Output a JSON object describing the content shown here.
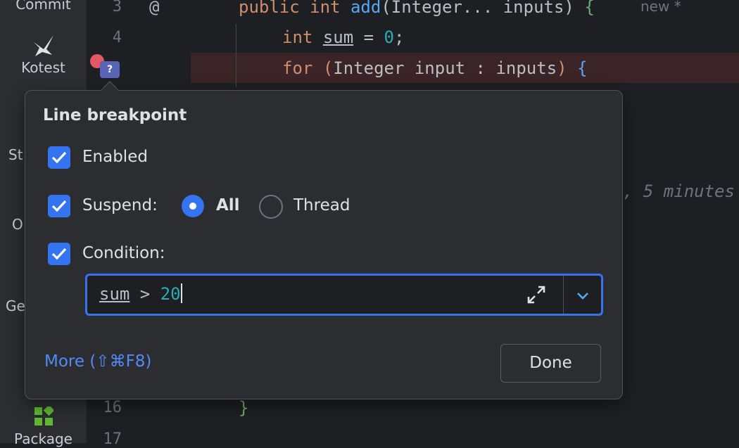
{
  "toolstrip": {
    "commit_label": "Commit",
    "kotest_label": "Kotest",
    "partial_st": "St",
    "partial_o": "O",
    "partial_ge": "Ge",
    "package_label": "Package"
  },
  "gutter": {
    "line_numbers": {
      "l3": "3",
      "l4": "4",
      "l16": "16",
      "l17": "17"
    },
    "annotation_symbol": "@",
    "breakpoint_badge": "?"
  },
  "editor": {
    "line3": {
      "kw_public": "public",
      "kw_int": "int",
      "method": "add",
      "open_paren": "(",
      "params": "Integer... inputs",
      "close_paren": ")",
      "brace": "{"
    },
    "new_tag": "new *",
    "line4": {
      "kw": "int",
      "var": "sum",
      "eq": " = ",
      "num": "0",
      "semi": ";"
    },
    "line5": {
      "kw": "for",
      "open_paren": "(",
      "body": "Integer input : inputs",
      "close_paren": ")",
      "brace": "{"
    },
    "ghost_text": ", 5 minutes",
    "closing_brace": "}"
  },
  "popup": {
    "title": "Line breakpoint",
    "enabled_label": "Enabled",
    "enabled_checked": true,
    "suspend_label": "Suspend:",
    "suspend_checked": true,
    "suspend_options": {
      "all": "All",
      "thread": "Thread"
    },
    "suspend_selected": "All",
    "condition_label": "Condition:",
    "condition_checked": true,
    "condition": {
      "var": "sum",
      "op": " > ",
      "value": "20"
    },
    "more_link": "More (⇧⌘F8)",
    "done_label": "Done"
  },
  "colors": {
    "accent": "#3574f0",
    "breakpoint": "#e55765",
    "link": "#548af7",
    "keyword": "#cf8e6d",
    "function": "#56a8f5",
    "number": "#2aacb8"
  },
  "icons": [
    "commit-icon",
    "kotest-icon",
    "package-icon",
    "breakpoint-icon",
    "expand-icon",
    "chevron-down-icon",
    "checkmark-icon"
  ]
}
